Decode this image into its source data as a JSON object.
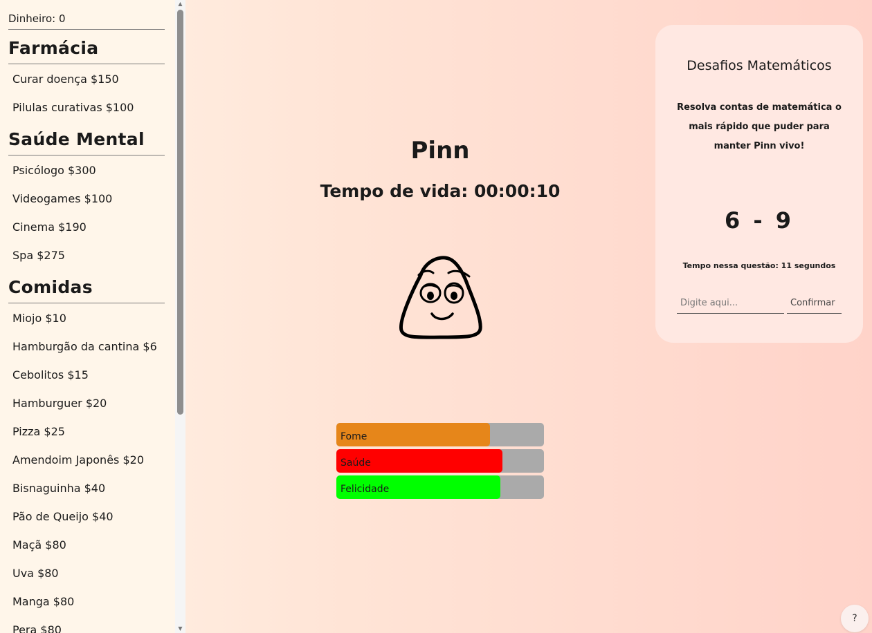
{
  "sidebar": {
    "money_label": "Dinheiro: 0",
    "sections": [
      {
        "title": "Farmácia",
        "items": [
          "Curar doença $150",
          "Pilulas curativas $100"
        ]
      },
      {
        "title": "Saúde Mental",
        "items": [
          "Psicólogo $300",
          "Videogames $100",
          "Cinema $190",
          "Spa $275"
        ]
      },
      {
        "title": "Comidas",
        "items": [
          "Miojo $10",
          "Hamburgão da cantina $6",
          "Cebolitos $15",
          "Hamburguer $20",
          "Pizza $25",
          "Amendoim Japonês $20",
          "Bisnaguinha $40",
          "Pão de Queijo $40",
          "Maçã $80",
          "Uva $80",
          "Manga $80",
          "Pera $80"
        ]
      }
    ]
  },
  "pet": {
    "name": "Pinn",
    "lifetime": "Tempo de vida: 00:00:10",
    "icon": "blob-pet-face"
  },
  "stats": [
    {
      "label": "Fome",
      "level": 0.74,
      "color": "#e6861a"
    },
    {
      "label": "Saúde",
      "level": 0.8,
      "color": "#ff0000"
    },
    {
      "label": "Felicidade",
      "level": 0.79,
      "color": "#00ff00"
    }
  ],
  "challenge": {
    "title": "Desafios Matemáticos",
    "description": "Resolva contas de matemática o mais rápido que puder para manter Pinn vivo!",
    "question": "6 - 9",
    "timer": "Tempo nessa questão: 11 segundos",
    "input_placeholder": "Digite aqui...",
    "input_value": "",
    "confirm_label": "Confirmar"
  },
  "help": {
    "label": "?"
  },
  "colors": {
    "sidebar_bg": "#fff6ea",
    "card_bg": "#ffe8e2",
    "bar_track": "#aaaaaa"
  }
}
